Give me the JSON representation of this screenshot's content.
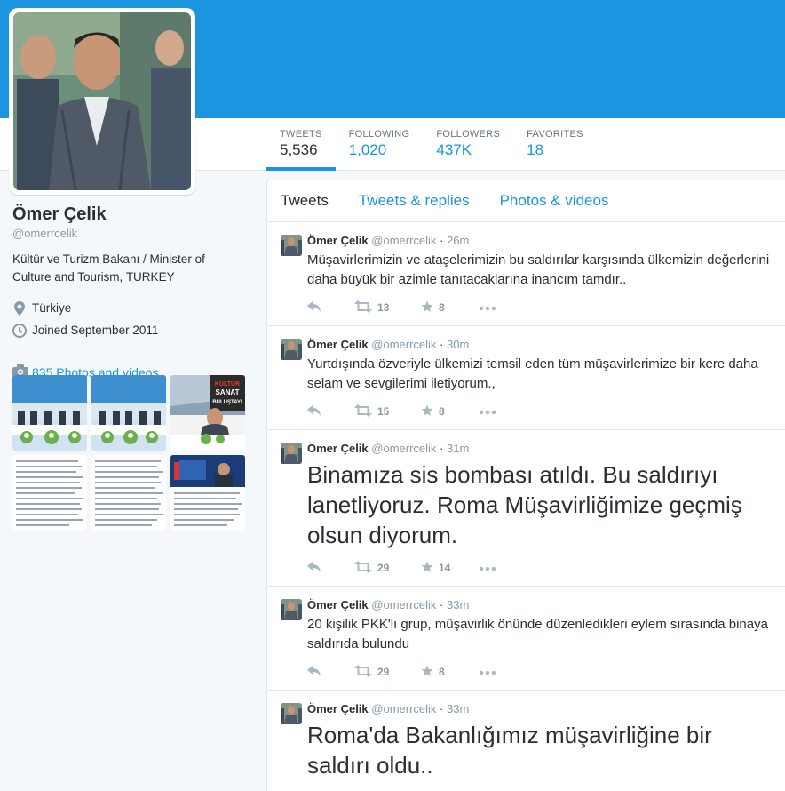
{
  "colors": {
    "accent": "#1b95e0",
    "text": "#292f33",
    "muted": "#8899a6"
  },
  "stats": [
    {
      "label": "TWEETS",
      "value": "5,536",
      "active": true
    },
    {
      "label": "FOLLOWING",
      "value": "1,020",
      "active": false
    },
    {
      "label": "FOLLOWERS",
      "value": "437K",
      "active": false
    },
    {
      "label": "FAVORITES",
      "value": "18",
      "active": false
    }
  ],
  "profile": {
    "name": "Ömer Çelik",
    "handle": "@omerrcelik",
    "bio": "Kültür ve Turizm Bakanı / Minister of Culture and Tourism, TURKEY",
    "location": "Türkiye",
    "location_icon": "location-pin-icon",
    "joined": "Joined September 2011",
    "joined_icon": "calendar-clock-icon",
    "photos_link": "835 Photos and videos",
    "photos_icon": "camera-icon"
  },
  "thumbs": [
    {
      "name": "photo-thumb-1"
    },
    {
      "name": "photo-thumb-2"
    },
    {
      "name": "photo-thumb-3",
      "overlay": [
        "KÜLTÜR",
        "SANAT",
        "BULUŞTAYI"
      ]
    },
    {
      "name": "photo-thumb-4"
    },
    {
      "name": "photo-thumb-5"
    },
    {
      "name": "photo-thumb-6"
    }
  ],
  "stream_tabs": [
    {
      "label": "Tweets",
      "active": true
    },
    {
      "label": "Tweets & replies",
      "active": false
    },
    {
      "label": "Photos & videos",
      "active": false
    }
  ],
  "tweets": [
    {
      "name": "Ömer Çelik",
      "handle": "@omerrcelik",
      "time": "26m",
      "text": "Müşavirlerimizin ve ataşelerimizin bu saldırılar karşısında ülkemizin değerlerini daha büyük bir azimle tanıtacaklarına inancım tamdır..",
      "big": false,
      "retweets": "13",
      "favorites": "8"
    },
    {
      "name": "Ömer Çelik",
      "handle": "@omerrcelik",
      "time": "30m",
      "text": "Yurtdışında özveriyle ülkemizi temsil eden tüm müşavirlerimize bir kere daha selam ve sevgilerimi iletiyorum.,",
      "big": false,
      "retweets": "15",
      "favorites": "8"
    },
    {
      "name": "Ömer Çelik",
      "handle": "@omerrcelik",
      "time": "31m",
      "text": "Binamıza sis bombası atıldı. Bu saldırıyı lanetliyoruz. Roma Müşavirliğimize geçmiş olsun diyorum.",
      "big": true,
      "retweets": "29",
      "favorites": "14"
    },
    {
      "name": "Ömer Çelik",
      "handle": "@omerrcelik",
      "time": "33m",
      "text": "20 kişilik PKK'lı grup, müşavirlik önünde düzenledikleri eylem sırasında binaya saldırıda bulundu",
      "big": false,
      "retweets": "29",
      "favorites": "8"
    },
    {
      "name": "Ömer Çelik",
      "handle": "@omerrcelik",
      "time": "33m",
      "text": "Roma'da Bakanlığımız müşavirliğine bir saldırı oldu..",
      "big": true,
      "retweets": "",
      "favorites": ""
    }
  ]
}
